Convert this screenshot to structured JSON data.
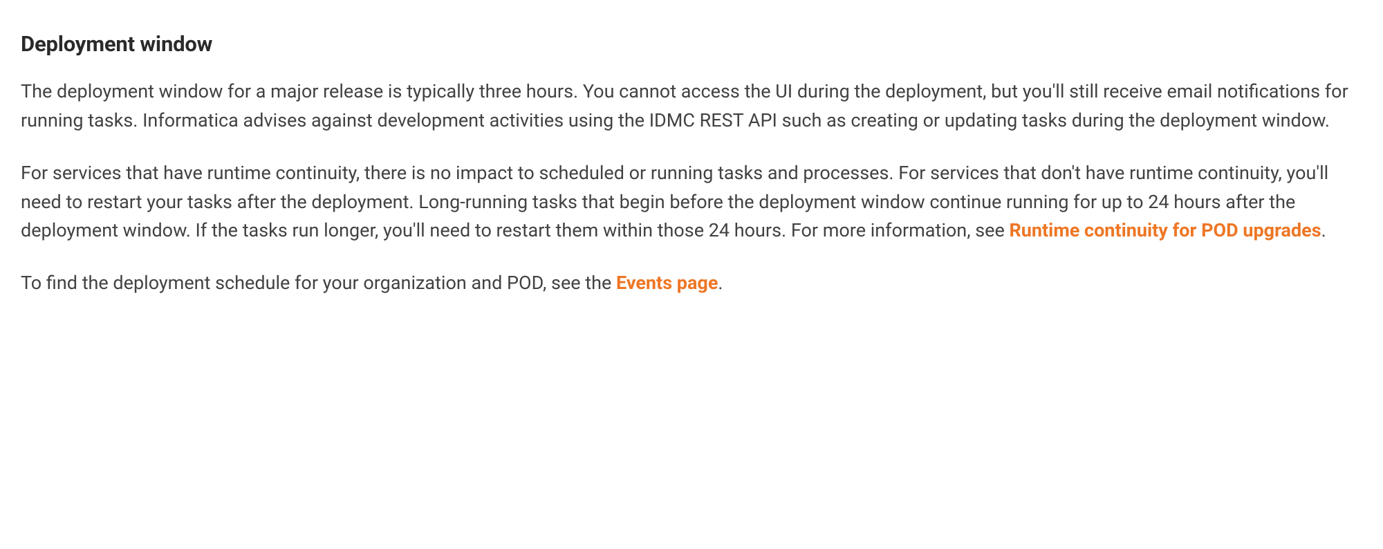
{
  "section": {
    "heading": "Deployment window",
    "paragraph1": "The deployment window for a major release is typically three hours. You cannot access the UI during the deployment, but you'll still receive email notifications for running tasks. Informatica advises against development activities using the IDMC REST API such as creating or updating tasks during the deployment window.",
    "paragraph2_part1": "For services that have runtime continuity, there is no impact to scheduled or running tasks and processes. For services that don't have runtime continuity, you'll need to restart your tasks after the deployment. Long-running tasks that begin before the deployment window continue running for up to 24 hours after the deployment window. If the tasks run longer, you'll need to restart them within those 24 hours. For more information, see ",
    "paragraph2_link": "Runtime continuity for POD upgrades",
    "paragraph2_part2": ".",
    "paragraph3_part1": "To find the deployment schedule for your organization and POD, see the ",
    "paragraph3_link": "Events page",
    "paragraph3_part2": "."
  }
}
